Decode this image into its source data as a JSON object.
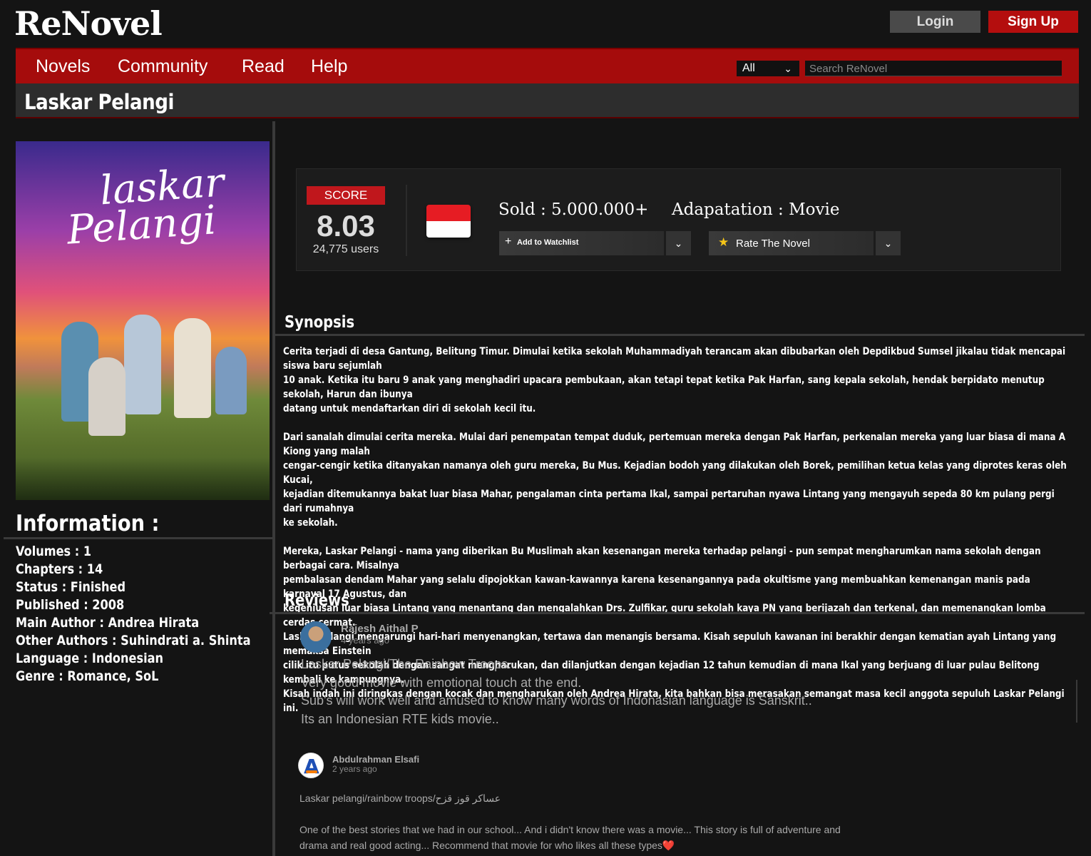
{
  "header": {
    "logo": "ReNovel",
    "login_label": "Login",
    "signup_label": "Sign Up"
  },
  "nav": {
    "items": [
      "Novels",
      "Community",
      "Read",
      "Help"
    ],
    "select_value": "All",
    "search_placeholder": "Search ReNovel"
  },
  "page_title": "Laskar Pelangi",
  "poster": {
    "title_line1": "laskar",
    "title_line2": "Pelangi"
  },
  "information": {
    "heading": "Information :",
    "items": [
      "Volumes : 1",
      "Chapters : 14",
      "Status : Finished",
      "Published : 2008",
      "Main Author :  Andrea Hirata",
      "Other Authors : Suhindrati a. Shinta",
      "Language : Indonesian",
      "Genre : Romance, SoL"
    ]
  },
  "score": {
    "label": "SCORE",
    "value": "8.03",
    "users": "24,775 users",
    "sold": "Sold : 5.000.000+",
    "adaptation": "Adapatation : Movie",
    "watchlist_label": "Add to Watchlist",
    "rate_label": "Rate The Novel"
  },
  "synopsis": {
    "heading": "Synopsis",
    "paragraphs": [
      "Cerita terjadi di desa Gantung, Belitung Timur. Dimulai ketika sekolah Muhammadiyah terancam akan dibubarkan oleh Depdikbud Sumsel jikalau tidak mencapai siswa baru sejumlah\n10 anak. Ketika itu baru 9 anak yang menghadiri upacara pembukaan, akan tetapi tepat ketika Pak Harfan, sang kepala sekolah, hendak berpidato menutup sekolah, Harun dan ibunya\ndatang untuk mendaftarkan diri di sekolah kecil itu.",
      "Dari sanalah dimulai cerita mereka. Mulai dari penempatan tempat duduk, pertemuan mereka dengan Pak Harfan, perkenalan mereka yang luar biasa di mana A Kiong yang malah\ncengar-cengir ketika ditanyakan namanya oleh guru mereka, Bu Mus. Kejadian bodoh yang dilakukan oleh Borek, pemilihan ketua kelas yang diprotes keras oleh Kucai,\nkejadian ditemukannya bakat luar biasa Mahar, pengalaman cinta pertama Ikal, sampai pertaruhan nyawa Lintang yang mengayuh sepeda 80 km pulang pergi dari rumahnya\n ke sekolah.",
      "Mereka, Laskar Pelangi - nama yang diberikan Bu Muslimah akan kesenangan mereka terhadap pelangi - pun sempat mengharumkan nama sekolah dengan berbagai cara. Misalnya\npembalasan dendam Mahar yang selalu dipojokkan kawan-kawannya karena kesenangannya pada okultisme yang membuahkan kemenangan manis pada karnaval 17 Agustus, dan\nkegeniusan luar biasa Lintang yang menantang dan mengalahkan Drs. Zulfikar, guru sekolah kaya PN yang berijazah dan terkenal, dan memenangkan lomba cerdas cermat.\nLaskar Pelangi mengarungi hari-hari menyenangkan, tertawa dan menangis bersama. Kisah sepuluh kawanan ini berakhir dengan kematian ayah Lintang yang memaksa Einstein\ncilik itu putus sekolah dengan sangat mengharukan, dan dilanjutkan dengan kejadian 12 tahun kemudian di mana Ikal yang berjuang di luar pulau Belitong kembali ke kampungnya.\nKisah indah ini diringkas dengan kocak dan mengharukan oleh Andrea Hirata, kita bahkan bisa merasakan semangat masa kecil anggota sepuluh Laskar Pelangi ini."
    ]
  },
  "reviews": {
    "heading": "Reviews",
    "items": [
      {
        "author": "Rajesh Aithal P",
        "time": "4 years ago",
        "lines": [
          "Laskar Pelangi/The Rainbow Troops..",
          "Very good movie with emotional touch at the end.",
          "Sub's will work well and amused to know many words of Indonasian language is Sanskrit..",
          "Its an Indonesian RTE kids movie.."
        ]
      },
      {
        "author": "Abdulrahman Elsafi",
        "time": "2 years ago",
        "lines": [
          "Laskar pelangi/rainbow troops/عساكر قوز قزح",
          "One of the best stories that we had in our school... And i didn't know there was a movie... This story is full of adventure and",
          "drama and real good acting... Recommend that movie for who likes all these types❤️"
        ]
      }
    ]
  },
  "colors": {
    "brand_red": "#a50c0c",
    "background": "#141414",
    "score_red": "#c0171c"
  }
}
